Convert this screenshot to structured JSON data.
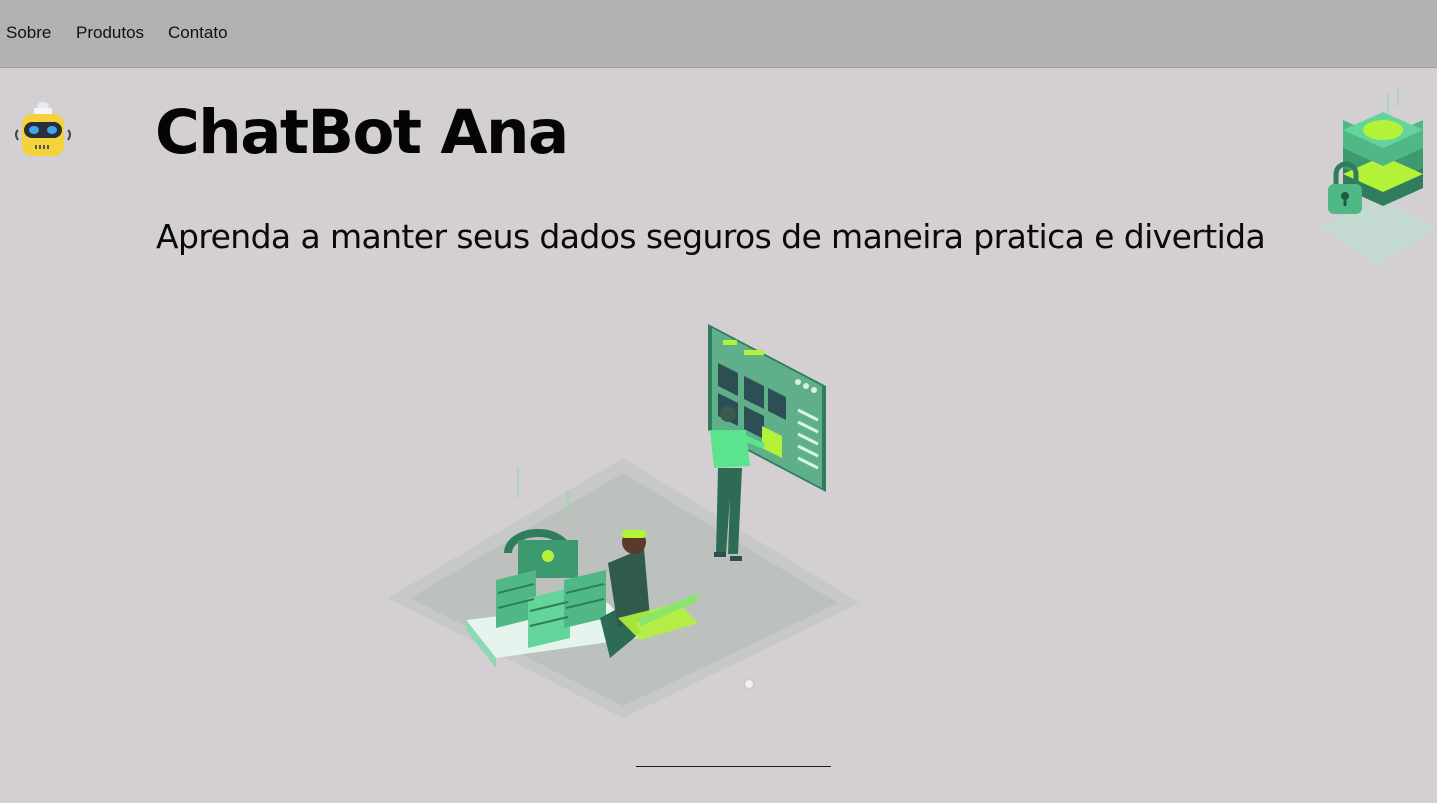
{
  "nav": {
    "items": [
      {
        "label": "Sobre"
      },
      {
        "label": "Produtos"
      },
      {
        "label": "Contato"
      }
    ]
  },
  "hero": {
    "title": "ChatBot Ana",
    "subtitle": "Aprenda a manter seus dados seguros de maneira pratica e divertida"
  },
  "carousel": {
    "active_index": 0,
    "count": 1
  },
  "colors": {
    "page_bg": "#d3cfd3",
    "navbar_bg": "#b3b1b3",
    "accent_green": "#5be38e",
    "lime": "#b4f23a",
    "robot_yellow": "#f4d23c"
  },
  "icons": {
    "logo": "robot-icon",
    "corner": "database-lock-icon",
    "hero": "security-illustration"
  }
}
